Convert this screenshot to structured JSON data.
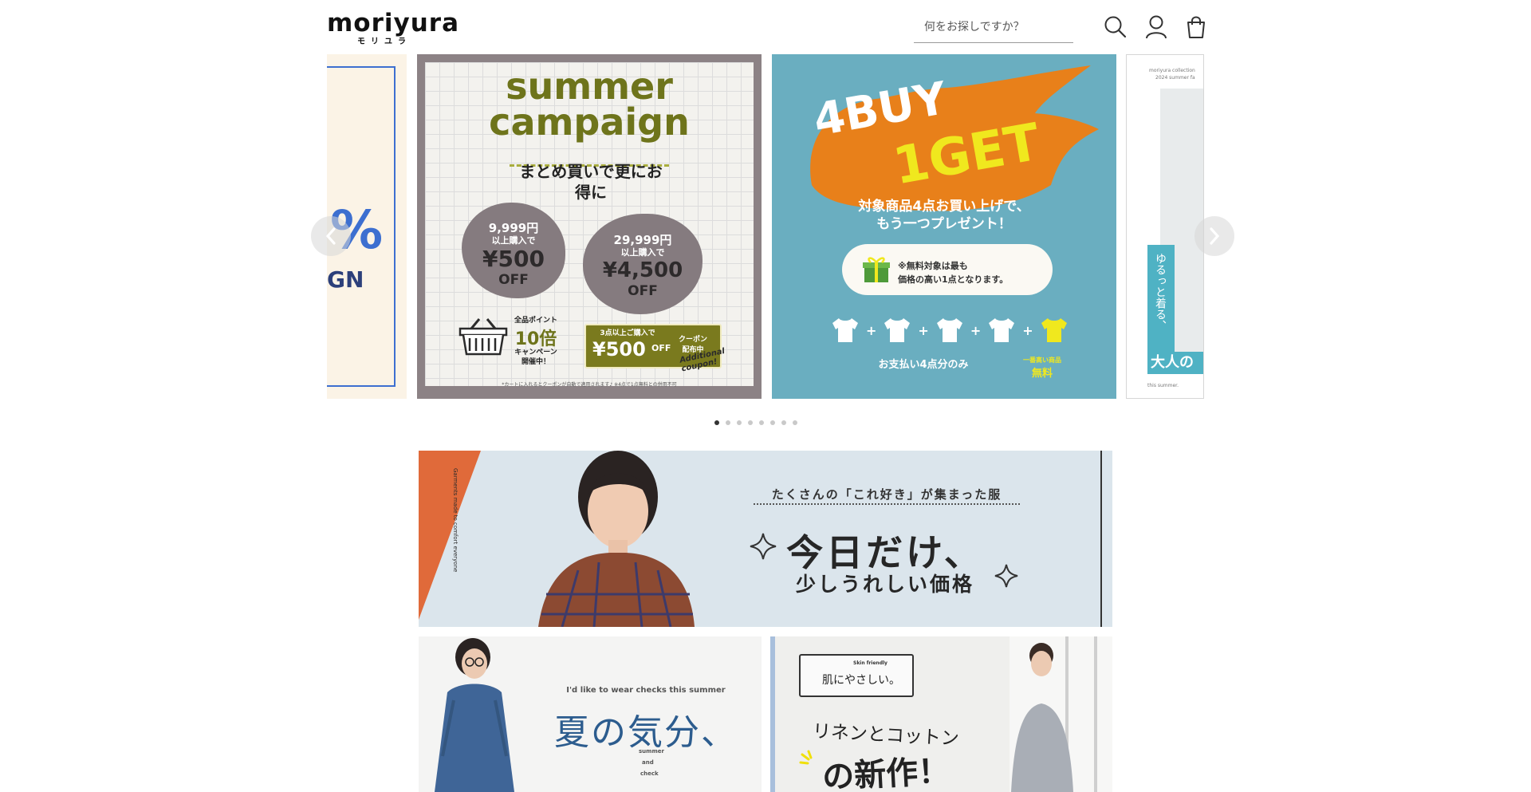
{
  "header": {
    "logo_text": "moriyura",
    "logo_subtext": "モリユラ",
    "search_placeholder": "何をお探しですか？"
  },
  "carousel": {
    "slide_count": 8,
    "active_slide": 1,
    "slides": [
      {
        "name": "campaign-percent",
        "lines": [
          "%",
          "GN"
        ]
      },
      {
        "name": "summer-campaign",
        "title_line1": "summer",
        "title_line2": "campaign",
        "tagline": "まとめ買いで更にお得に",
        "offer1_amount": "9,999円",
        "offer1_condition": "以上購入で",
        "offer1_discount": "¥500",
        "offer1_off": "OFF",
        "offer2_amount": "29,999円",
        "offer2_condition": "以上購入で",
        "offer2_discount": "¥4,500",
        "offer2_off": "OFF",
        "points_line1": "全品ポイント",
        "points_multiplier": "10倍",
        "points_line2": "キャンペーン",
        "points_line3": "開催中！",
        "coupon_line1": "3点以上ご購入で",
        "coupon_amount": "¥500",
        "coupon_off": "OFF",
        "coupon_tag1": "クーポン",
        "coupon_tag2": "配布中",
        "coupon_script": "Additional coupon!",
        "footnote": "*カートに入れるとクーポンが自動で適用されます♪ ※4点で1点無料との併用不可"
      },
      {
        "name": "4buy-1get",
        "headline1": "4BUY",
        "headline2": "1GET",
        "sub1": "対象商品4点お買い上げで、",
        "sub2": "もう一つプレゼント！",
        "note1": "※無料対象は最も",
        "note2": "価格の高い1点となります。",
        "pay_label": "お支払い4点分のみ",
        "free_label1": "一番高い商品",
        "free_label2": "無料"
      },
      {
        "name": "summer-collection",
        "top_text1": "moriyura collection",
        "top_text2": "2024 summer fa",
        "vertical_text": "ゆるっと着る、",
        "bottom_text": "大人の",
        "footer_text": "this summer."
      }
    ]
  },
  "banners": {
    "today": {
      "catch": "たくさんの「これ好き」が集まった服",
      "title": "今日だけ、",
      "subtitle": "少しうれしい価格",
      "side_text": "Garments made to comfort everyone"
    },
    "checks": {
      "en": "I'd like to wear checks this summer",
      "title": "夏の気分、",
      "side1": "summer",
      "side2": "and",
      "side3": "check"
    },
    "linen": {
      "tag_en": "Skin friendly",
      "tag_jp": "肌にやさしい。",
      "line1": "リネンとコットン",
      "line2": "の新作！"
    }
  },
  "colors": {
    "summer_bg": "#f3f2ee",
    "summer_frame": "#8c8285",
    "olive": "#7a7a1e",
    "blob": "#857b7f",
    "buy_bg": "#6aaec0",
    "flame": "#e8801a",
    "yellow": "#f0e81e",
    "today_bg": "#d8e3ea",
    "accent_orange": "#e06a3a"
  }
}
